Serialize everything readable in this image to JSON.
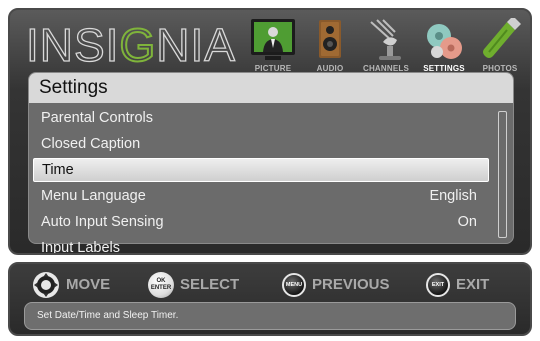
{
  "brand": {
    "logo_text": "INSIGNIA"
  },
  "tabs": [
    {
      "id": "picture",
      "label": "PICTURE",
      "icon": "tv-presenter-icon",
      "active": false
    },
    {
      "id": "audio",
      "label": "AUDIO",
      "icon": "speaker-icon",
      "active": false
    },
    {
      "id": "channels",
      "label": "CHANNELS",
      "icon": "satellite-antenna-icon",
      "active": false
    },
    {
      "id": "settings",
      "label": "SETTINGS",
      "icon": "gears-icon",
      "active": true
    },
    {
      "id": "photos",
      "label": "PHOTOS",
      "icon": "usb-drive-icon",
      "active": false
    }
  ],
  "main": {
    "title": "Settings",
    "items": [
      {
        "label": "Parental Controls",
        "value": ""
      },
      {
        "label": "Closed Caption",
        "value": ""
      },
      {
        "label": "Time",
        "value": "",
        "selected": true
      },
      {
        "label": "Menu Language",
        "value": "English"
      },
      {
        "label": "Auto Input Sensing",
        "value": "On"
      },
      {
        "label": "Input Labels",
        "value": ""
      }
    ]
  },
  "controls": {
    "move_label": "MOVE",
    "select_label": "SELECT",
    "select_btn_line1": "OK",
    "select_btn_line2": "ENTER",
    "previous_label": "PREVIOUS",
    "previous_btn": "MENU",
    "exit_label": "EXIT",
    "exit_btn": "EXIT"
  },
  "help": {
    "text": "Set Date/Time and Sleep Timer."
  },
  "colors": {
    "accent_green": "#7fb43b",
    "panel_dark": "#2a2a2a",
    "content_gray": "#6b6b6b"
  }
}
